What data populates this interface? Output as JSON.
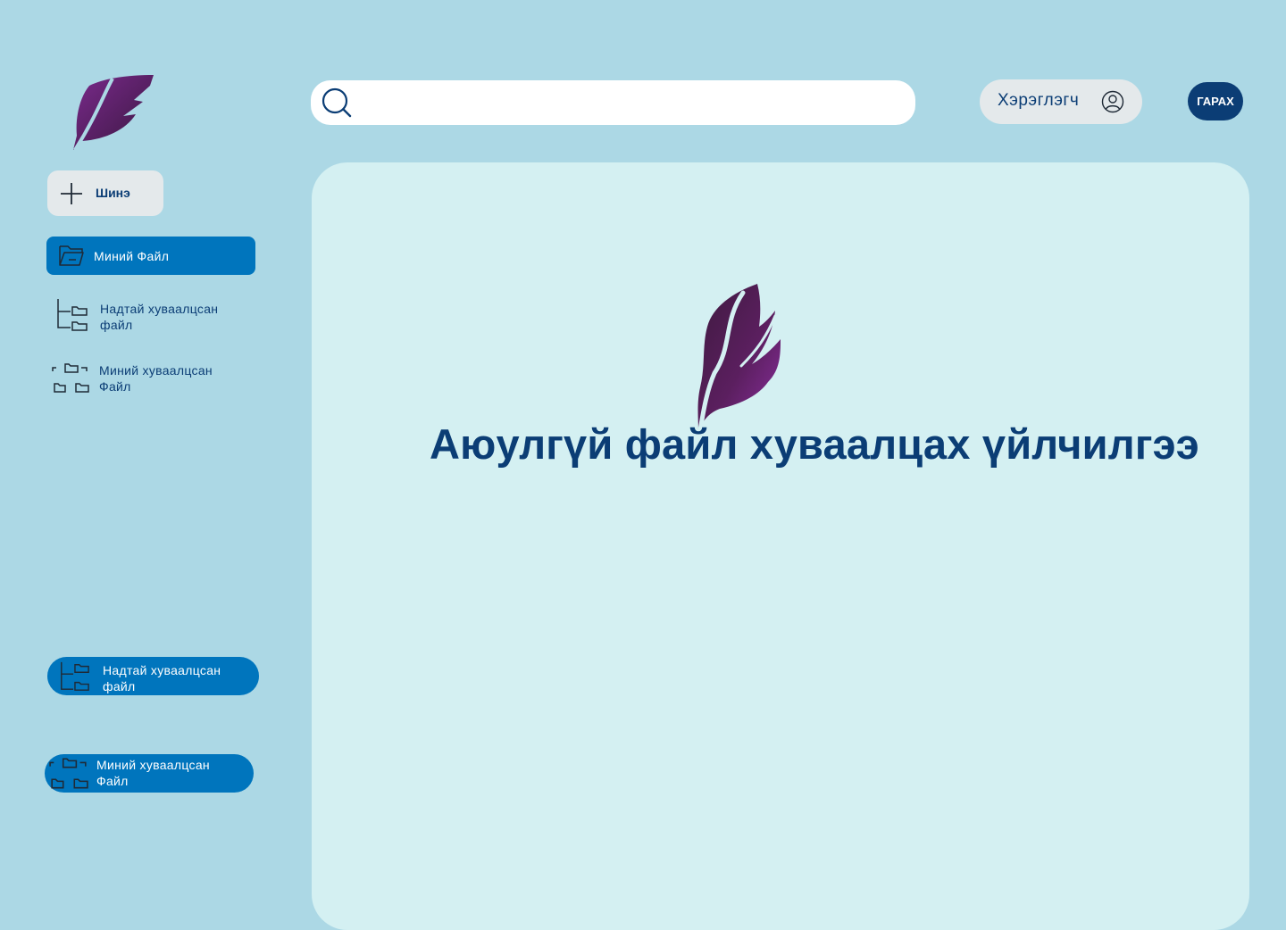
{
  "header": {
    "search": {
      "value": "",
      "placeholder": ""
    },
    "user": {
      "label": "Хэрэглэгч"
    },
    "logout": {
      "label": "ГАРАХ"
    }
  },
  "sidebar": {
    "new_button": {
      "label": "Шинэ"
    },
    "items": [
      {
        "label": "Миний Файл",
        "active": true
      },
      {
        "label": "Надтай хуваалцсан\nфайл",
        "active": false
      },
      {
        "label": "Миний хуваалцсан\nФайл",
        "active": false
      },
      {
        "label": "Надтай хуваалцсан\nфайл",
        "active": true
      },
      {
        "label": "Миний хуваалцсан\nФайл",
        "active": true
      }
    ]
  },
  "main": {
    "title": "Аюулгүй файл хуваалцах үйлчилгээ"
  },
  "colors": {
    "background": "#acd8e5",
    "panel": "#d4f0f2",
    "primary": "#0075bd",
    "dark_blue": "#0b3d75",
    "logo_purple": "#6a2476"
  },
  "icons": [
    "feather-logo",
    "search-icon",
    "user-icon",
    "plus-icon",
    "folder-open-icon",
    "folder-tree-icon",
    "folder-network-icon"
  ]
}
